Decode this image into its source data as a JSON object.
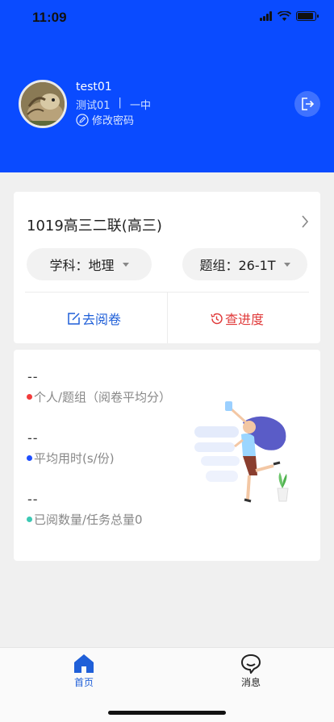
{
  "status": {
    "time": "11:09"
  },
  "user": {
    "name": "test01",
    "display_name": "测试01",
    "separator": "|",
    "school": "一中",
    "change_password": "修改密码"
  },
  "exam": {
    "title": "1019高三二联(高三)",
    "subject_label": "学科：地理",
    "group_label": "题组：26-1T",
    "review_label": "去阅卷",
    "progress_label": "查进度"
  },
  "stats": [
    {
      "value": "--",
      "label": "个人/题组（阅卷平均分）",
      "color": "#f23b3b"
    },
    {
      "value": "--",
      "label": "平均用时(s/份)",
      "color": "#1f4fff"
    },
    {
      "value": "--",
      "label": "已阅数量/任务总量0",
      "color": "#3cc9b4"
    }
  ],
  "tabs": {
    "home": "首页",
    "messages": "消息"
  },
  "colors": {
    "brand": "#0a4bff",
    "review": "#1f5fd8",
    "progress": "#e03a3a"
  }
}
